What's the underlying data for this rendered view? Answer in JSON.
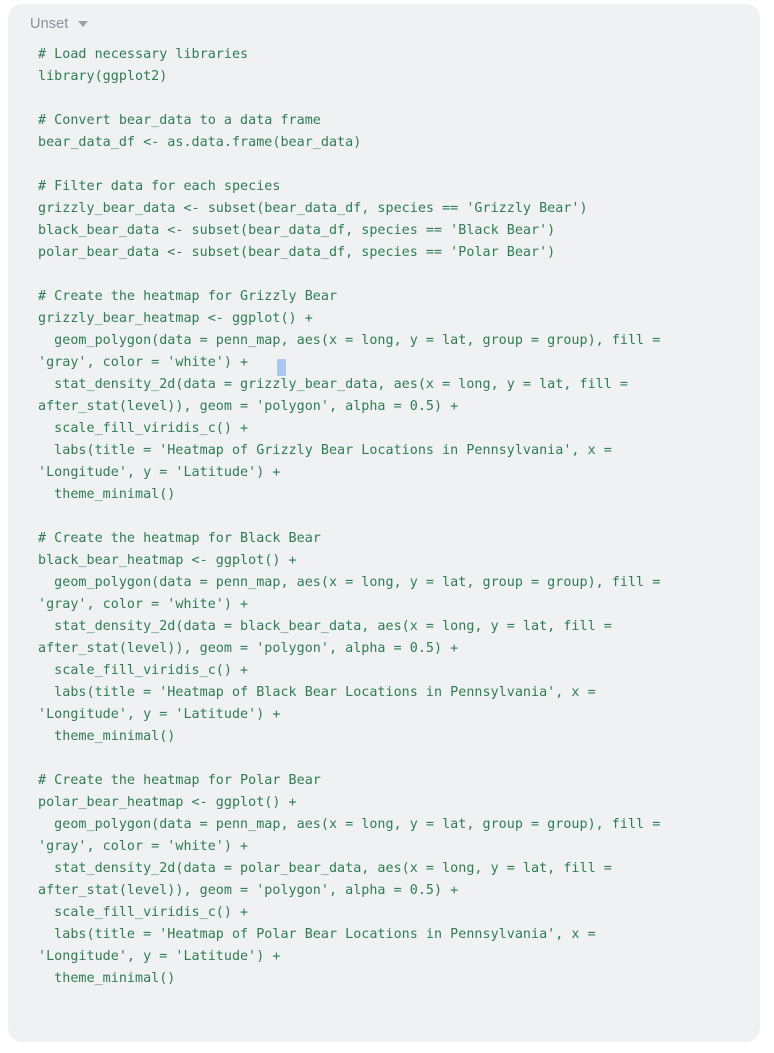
{
  "panel": {
    "language_selector": {
      "label": "Unset",
      "chevron_icon": "chevron-down-icon"
    },
    "background_color": "#f0f1f3",
    "code_color": "#2e7d52",
    "caret_color": "#adc6ef",
    "code_lines": [
      "# Load necessary libraries",
      "library(ggplot2)",
      "",
      "# Convert bear_data to a data frame",
      "bear_data_df <- as.data.frame(bear_data)",
      "",
      "# Filter data for each species",
      "grizzly_bear_data <- subset(bear_data_df, species == 'Grizzly Bear')",
      "black_bear_data <- subset(bear_data_df, species == 'Black Bear')",
      "polar_bear_data <- subset(bear_data_df, species == 'Polar Bear')",
      "",
      "# Create the heatmap for Grizzly Bear",
      "grizzly_bear_heatmap <- ggplot() +",
      "  geom_polygon(data = penn_map, aes(x = long, y = lat, group = group), fill =",
      "'gray', color = 'white') +",
      "  stat_density_2d(data = grizzly_bear_data, aes(x = long, y = lat, fill =",
      "after_stat(level)), geom = 'polygon', alpha = 0.5) +",
      "  scale_fill_viridis_c() +",
      "  labs(title = 'Heatmap of Grizzly Bear Locations in Pennsylvania', x =",
      "'Longitude', y = 'Latitude') +",
      "  theme_minimal()",
      "",
      "# Create the heatmap for Black Bear",
      "black_bear_heatmap <- ggplot() +",
      "  geom_polygon(data = penn_map, aes(x = long, y = lat, group = group), fill =",
      "'gray', color = 'white') +",
      "  stat_density_2d(data = black_bear_data, aes(x = long, y = lat, fill =",
      "after_stat(level)), geom = 'polygon', alpha = 0.5) +",
      "  scale_fill_viridis_c() +",
      "  labs(title = 'Heatmap of Black Bear Locations in Pennsylvania', x =",
      "'Longitude', y = 'Latitude') +",
      "  theme_minimal()",
      "",
      "# Create the heatmap for Polar Bear",
      "polar_bear_heatmap <- ggplot() +",
      "  geom_polygon(data = penn_map, aes(x = long, y = lat, group = group), fill =",
      "'gray', color = 'white') +",
      "  stat_density_2d(data = polar_bear_data, aes(x = long, y = lat, fill =",
      "after_stat(level)), geom = 'polygon', alpha = 0.5) +",
      "  scale_fill_viridis_c() +",
      "  labs(title = 'Heatmap of Polar Bear Locations in Pennsylvania', x =",
      "'Longitude', y = 'Latitude') +",
      "  theme_minimal()"
    ]
  }
}
